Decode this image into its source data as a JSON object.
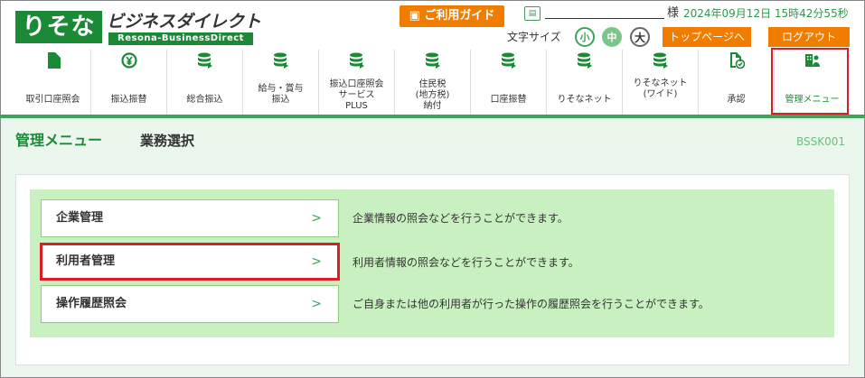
{
  "header": {
    "logo": "りそな",
    "logo_text": "ビジネスダイレクト",
    "logo_sub": "Resona-BusinessDirect",
    "guide_button": "ご利用ガイド",
    "user_suffix": "様",
    "datetime": "2024年09月12日 15時42分55秒",
    "font_size_label": "文字サイズ",
    "font_small": "小",
    "font_mid": "中",
    "font_large": "大",
    "top_page_button": "トップページへ",
    "logout_button": "ログアウト"
  },
  "nav": {
    "items": [
      {
        "label": "取引口座照会",
        "icon": "document-icon"
      },
      {
        "label": "振込振替",
        "icon": "yen-icon"
      },
      {
        "label": "総合振込",
        "icon": "database-icon"
      },
      {
        "label": "給与・賞与\n振込",
        "icon": "database-icon"
      },
      {
        "label": "振込口座照会\nサービス\nPLUS",
        "icon": "database-icon"
      },
      {
        "label": "住民税\n(地方税)\n納付",
        "icon": "database-icon"
      },
      {
        "label": "口座振替",
        "icon": "database-icon"
      },
      {
        "label": "りそなネット",
        "icon": "database-icon"
      },
      {
        "label": "りそなネット\n(ワイド)",
        "icon": "database-icon"
      },
      {
        "label": "承認",
        "icon": "approve-icon"
      },
      {
        "label": "管理メニュー",
        "icon": "admin-icon"
      }
    ]
  },
  "page": {
    "title": "管理メニュー",
    "subtitle": "業務選択",
    "screen_id": "BSSK001"
  },
  "menu": [
    {
      "label": "企業管理",
      "description": "企業情報の照会などを行うことができます。"
    },
    {
      "label": "利用者管理",
      "description": "利用者情報の照会などを行うことができます。"
    },
    {
      "label": "操作履歴照会",
      "description": "ご自身または他の利用者が行った操作の履歴照会を行うことができます。"
    }
  ],
  "colors": {
    "brand_green": "#1a8a37",
    "accent_orange": "#f07d00",
    "highlight_red": "#d81f26",
    "panel_green": "#c8f0c0"
  }
}
